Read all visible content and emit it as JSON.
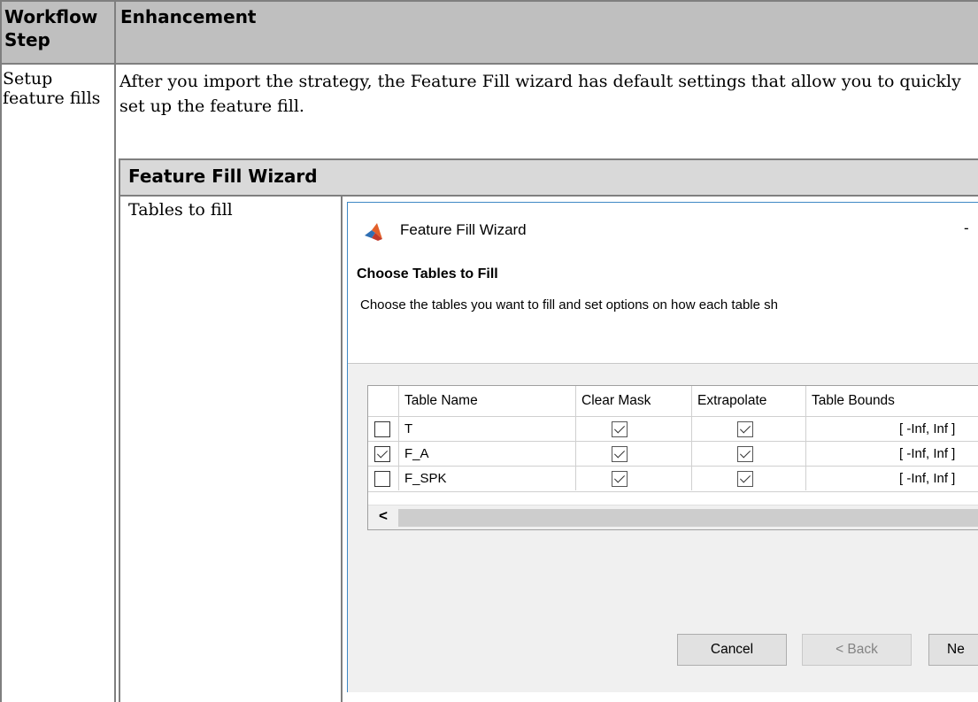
{
  "table": {
    "headers": {
      "step": "Workflow Step",
      "enhancement": "Enhancement"
    },
    "row": {
      "step": "Setup feature fills",
      "description": "After you import the strategy, the Feature Fill wizard has default settings that allow you to quickly set up the feature fill."
    }
  },
  "inner_table": {
    "header": "Feature Fill Wizard",
    "row_label": "Tables to fill"
  },
  "wizard": {
    "window_title": "Feature Fill Wizard",
    "window_control": "-",
    "heading": "Choose Tables to Fill",
    "instruction": "Choose the tables you want to fill and set options on how each table sh",
    "columns": [
      "Table Name",
      "Clear Mask",
      "Extrapolate",
      "Table Bounds"
    ],
    "rows": [
      {
        "name": "T",
        "selected": false,
        "clear_mask": true,
        "extrapolate": true,
        "bounds": "[ -Inf, Inf ]"
      },
      {
        "name": "F_A",
        "selected": true,
        "clear_mask": true,
        "extrapolate": true,
        "bounds": "[ -Inf, Inf ]"
      },
      {
        "name": "F_SPK",
        "selected": false,
        "clear_mask": true,
        "extrapolate": true,
        "bounds": "[ -Inf, Inf ]"
      }
    ],
    "scroll_left": "<",
    "buttons": {
      "cancel": "Cancel",
      "back": "< Back",
      "next": "Ne"
    }
  }
}
